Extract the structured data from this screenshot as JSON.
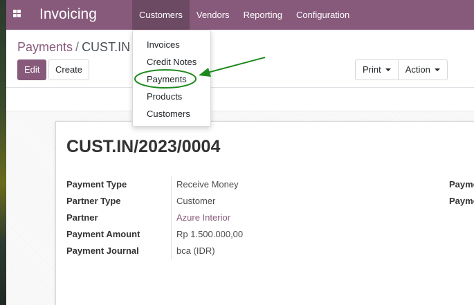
{
  "navbar": {
    "app_title": "Invoicing",
    "menu": [
      "Customers",
      "Vendors",
      "Reporting",
      "Configuration"
    ],
    "active": "Customers",
    "color": "#875a7b"
  },
  "customers_dropdown": {
    "items": [
      "Invoices",
      "Credit Notes",
      "Payments",
      "Products",
      "Customers"
    ],
    "highlighted": "Payments"
  },
  "breadcrumb": {
    "parent": "Payments",
    "separator": "/",
    "current": "CUST.IN"
  },
  "toolbar": {
    "edit_label": "Edit",
    "create_label": "Create",
    "print_label": "Print",
    "action_label": "Action"
  },
  "record": {
    "title": "CUST.IN/2023/0004",
    "fields": [
      {
        "label": "Payment Type",
        "value": "Receive Money"
      },
      {
        "label": "Partner Type",
        "value": "Customer"
      },
      {
        "label": "Partner",
        "value": "Azure Interior"
      },
      {
        "label": "Payment Amount",
        "value": "Rp 1.500.000,00"
      },
      {
        "label": "Payment Journal",
        "value": "bca (IDR)"
      }
    ],
    "right_fields": [
      {
        "label": "Payme"
      },
      {
        "label": "Payme"
      }
    ]
  },
  "annotation": {
    "arrow_color": "#1e8a1e",
    "target": "Payments"
  }
}
